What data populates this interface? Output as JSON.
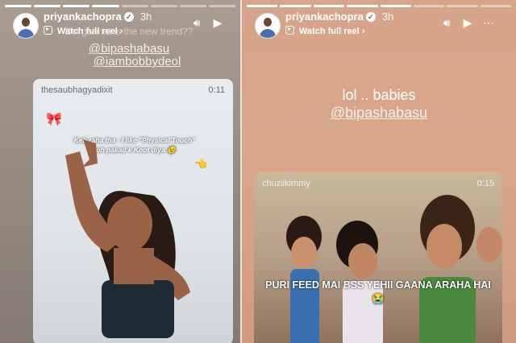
{
  "left_story": {
    "username": "priyankachopra",
    "time": "3h",
    "watch_label": "Watch full reel",
    "question_text": "Bol gaanat is the new trend??",
    "mentions": [
      "@bipashabasu",
      "@iambobbydeol"
    ],
    "reel": {
      "account": "thesaubhagyadixit",
      "duration": "0:11",
      "caption_line1": "Keh raha tha - I like \"Physical Touch\"",
      "caption_line2": "toh pakad k Koot diya 😉"
    }
  },
  "right_story": {
    "username": "priyankachopra",
    "time": "3h",
    "watch_label": "Watch full reel",
    "text": "lol .. babies",
    "mention": "@bipashabasu",
    "reel": {
      "account": "chuziikimmy",
      "duration": "0:15",
      "caption": "PURI FEED MAI BSS YEHII GAANA ARAHA HAI 😭"
    }
  },
  "icons": {
    "sound": "speaker-icon",
    "play": "play-icon",
    "chevron": "chevron-right-icon",
    "reel": "reel-icon",
    "verified": "verified-badge-icon"
  }
}
